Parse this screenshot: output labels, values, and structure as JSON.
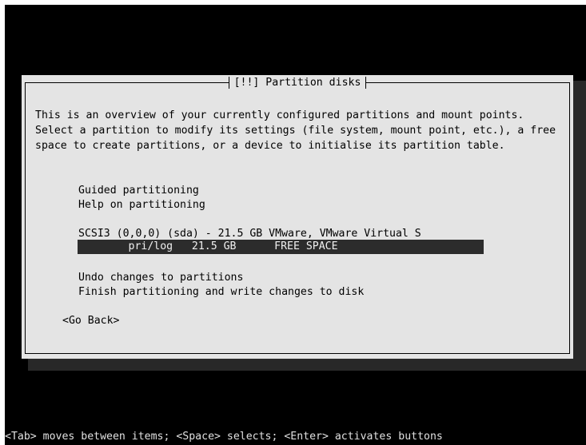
{
  "dialog": {
    "title": "[!!] Partition disks",
    "description": "This is an overview of your currently configured partitions and mount points. Select a partition to modify its settings (file system, mount point, etc.), a free space to create partitions, or a device to initialise its partition table.",
    "menu": {
      "guided": "Guided partitioning",
      "help": "Help on partitioning",
      "disk": "SCSI3 (0,0,0) (sda) - 21.5 GB VMware, VMware Virtual S",
      "free_space": "        pri/log   21.5 GB      FREE SPACE",
      "undo": "Undo changes to partitions",
      "finish": "Finish partitioning and write changes to disk"
    },
    "go_back": "<Go Back>"
  },
  "status_bar": "<Tab> moves between items; <Space> selects; <Enter> activates buttons"
}
